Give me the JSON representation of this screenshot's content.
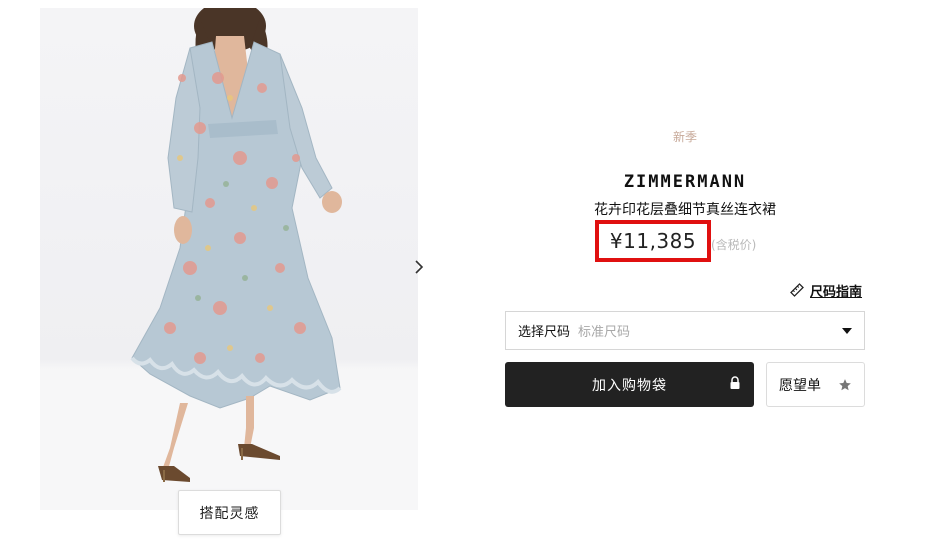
{
  "product": {
    "season_badge": "新季",
    "brand": "ZIMMERMANN",
    "name": "花卉印花层叠细节真丝连衣裙",
    "price": "¥11,385",
    "tax_note": "(含税价)"
  },
  "gallery": {
    "next_icon": "chevron-right-icon",
    "inspiration_button": "搭配灵感"
  },
  "size_guide": {
    "label": "尺码指南",
    "icon": "ruler-icon"
  },
  "size_selector": {
    "label": "选择尺码",
    "value": "标准尺码",
    "icon": "caret-down-icon"
  },
  "actions": {
    "add_to_bag": "加入购物袋",
    "add_to_bag_icon": "lock-icon",
    "wishlist": "愿望单",
    "wishlist_icon": "star-icon"
  },
  "colors": {
    "highlight_box": "#e01010",
    "primary_button": "#222222",
    "season_badge": "#c7a999"
  }
}
